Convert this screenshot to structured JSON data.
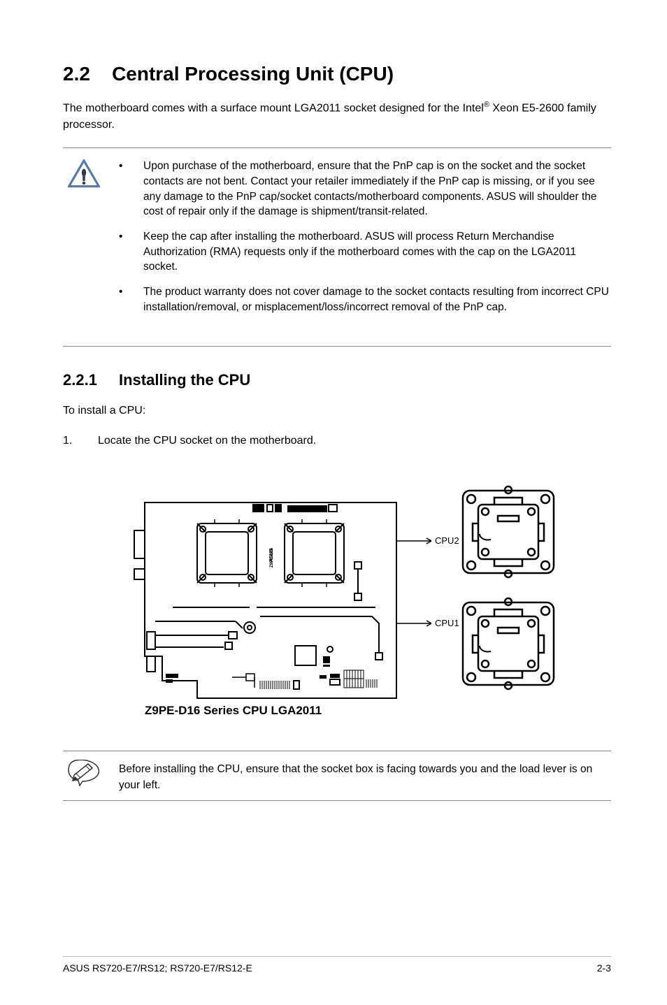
{
  "section": {
    "number": "2.2",
    "title": "Central Processing Unit (CPU)"
  },
  "intro": {
    "line1": "The motherboard comes with a surface mount LGA2011 socket designed for the Intel",
    "sup": "®",
    "line2": " Xeon E5-2600 family processor."
  },
  "caution_bullets": [
    "Upon purchase of the motherboard, ensure that the PnP cap is on the socket and the socket contacts are not bent. Contact your retailer immediately if the PnP cap is missing, or if you see any damage to the PnP cap/socket contacts/motherboard components. ASUS will shoulder the cost of repair only if the damage is shipment/transit-related.",
    "Keep the cap after installing the motherboard. ASUS will process Return Merchandise Authorization (RMA) requests only if the motherboard comes with the cap on the LGA2011 socket.",
    "The product warranty does not cover damage to the socket contacts resulting from incorrect CPU installation/removal, or misplacement/loss/incorrect removal of the PnP cap."
  ],
  "subsection": {
    "number": "2.2.1",
    "title": "Installing the CPU"
  },
  "install_intro": "To install a CPU:",
  "steps": [
    "Locate the CPU socket on the motherboard."
  ],
  "diagram": {
    "caption": "Z9PE-D16 Series CPU LGA2011",
    "labels": {
      "cpu1": "CPU1",
      "cpu2": "CPU2"
    },
    "board_text": "ASUS Z9PE-D16"
  },
  "note": "Before installing the CPU, ensure that the socket box is facing towards you and the load lever is on your left.",
  "footer": {
    "left": "ASUS RS720-E7/RS12; RS720-E7/RS12-E",
    "right": "2-3"
  }
}
